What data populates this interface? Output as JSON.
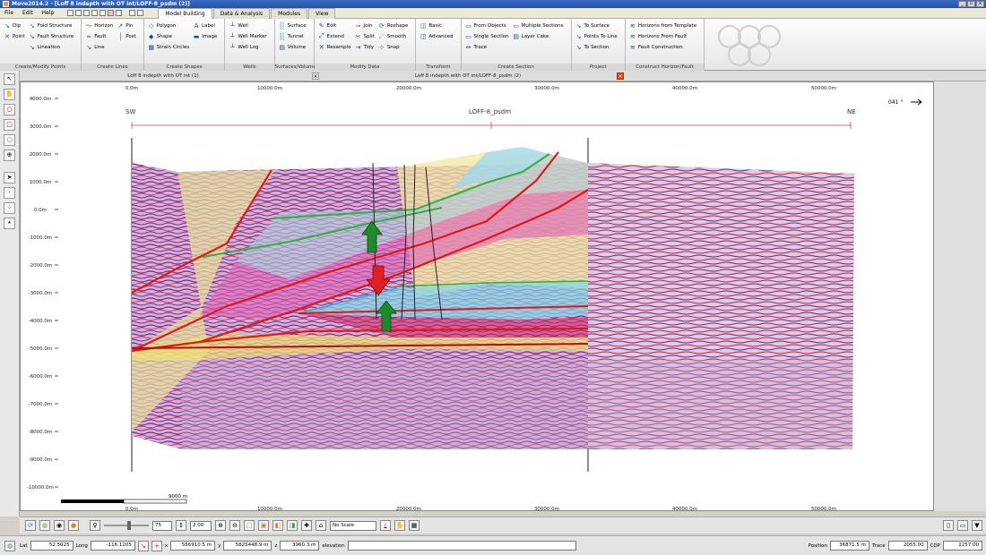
{
  "window": {
    "title": "Move2014.2 - [Loff 8 indepth with OT int/LOFF-8_psdm (2)]"
  },
  "menu": [
    "File",
    "Edit",
    "Help"
  ],
  "tabs": [
    "Model Building",
    "Data & Analysis",
    "Modules",
    "View"
  ],
  "ribbon": {
    "groups": [
      {
        "title": "Create/Modify Points",
        "cols": [
          [
            [
              "↘",
              "Dip"
            ],
            [
              "✕",
              "Point"
            ]
          ],
          [
            [
              "↘",
              "Fold Structure"
            ],
            [
              "↘",
              "Fault Structure"
            ],
            [
              "↘",
              "Lineation"
            ]
          ]
        ]
      },
      {
        "title": "Create Lines",
        "cols": [
          [
            [
              "〜",
              "Horizon"
            ],
            [
              "≈",
              "Fault"
            ],
            [
              "↘",
              "Line"
            ]
          ],
          [
            [
              "↗",
              "Pin"
            ],
            [
              "│",
              "Post"
            ]
          ]
        ]
      },
      {
        "title": "Create Shapes",
        "cols": [
          [
            [
              "◇",
              "Polygon"
            ],
            [
              "◆",
              "Shape"
            ],
            [
              "▦",
              "Strain Circles"
            ]
          ],
          [
            [
              "A",
              "Label"
            ],
            [
              "▬",
              "Image"
            ]
          ]
        ]
      },
      {
        "title": "Wells",
        "cols": [
          [
            [
              "┴",
              "Well"
            ],
            [
              "┴",
              "Well Marker"
            ],
            [
              "┴",
              "Well Log"
            ]
          ]
        ]
      },
      {
        "title": "Surfaces/Volumes",
        "cols": [
          [
            [
              "░",
              "Surface"
            ],
            [
              "░",
              "Tunnel"
            ],
            [
              "▤",
              "Volume"
            ]
          ]
        ]
      },
      {
        "title": "Modify Data",
        "cols": [
          [
            [
              "✎",
              "Edit"
            ],
            [
              "⤢",
              "Extend"
            ],
            [
              "✕",
              "Resample"
            ]
          ],
          [
            [
              "⊸",
              "Join"
            ],
            [
              "✂",
              "Split"
            ],
            [
              "⇥",
              "Tidy"
            ]
          ],
          [
            [
              "⟳",
              "Reshape"
            ],
            [
              "☄",
              "Smooth"
            ],
            [
              "⊹",
              "Snap"
            ]
          ]
        ]
      },
      {
        "title": "Transform",
        "cols": [
          [
            [
              "◫",
              "Basic"
            ],
            [
              "◫",
              "Advanced"
            ]
          ]
        ]
      },
      {
        "title": "Create Section",
        "cols": [
          [
            [
              "▭",
              "From Objects"
            ],
            [
              "▭",
              "Single Section"
            ],
            [
              "↔",
              "Trace"
            ]
          ],
          [
            [
              "▭",
              "Multiple Sections"
            ],
            [
              "▤",
              "Layer Cake"
            ]
          ]
        ]
      },
      {
        "title": "Project",
        "cols": [
          [
            [
              "↘",
              "To Surface"
            ],
            [
              "↘",
              "Points To Line"
            ],
            [
              "↘",
              "To Section"
            ]
          ]
        ]
      },
      {
        "title": "Construct Horizon/Fault",
        "cols": [
          [
            [
              "≋",
              "Horizons from Template"
            ],
            [
              "≋",
              "Horizons From Fault"
            ],
            [
              "≋",
              "Fault Construction"
            ]
          ]
        ]
      }
    ]
  },
  "doc_tabs": {
    "left": "Loff 8 indepth with OT int (1)",
    "right": "Loff 8 indepth with OT int/LOFF-8_psdm (2)"
  },
  "section": {
    "sw": "SW",
    "ne": "NE",
    "name": "LOFF-8_psdm",
    "azimuth": "041 °",
    "x_ticks": [
      "0.0m",
      "10000.0m",
      "20000.0m",
      "30000.0m",
      "40000.0m",
      "50000.0m"
    ],
    "y_ticks": [
      "4000.0m",
      "3000.0m",
      "2000.0m",
      "1000.0m",
      "0.0m",
      "-1000.0m",
      "-2000.0m",
      "-3000.0m",
      "-4000.0m",
      "-5000.0m",
      "-6000.0m",
      "-7000.0m",
      "-8000.0m",
      "-9000.0m",
      "-10000.0m"
    ],
    "scale_label": "9000 m"
  },
  "bottom_toolbar": {
    "zoom": "75",
    "exaggeration": "2.00",
    "scale_select": "No Scale"
  },
  "status": {
    "lat_label": "Lat",
    "lat": "52.5025",
    "long_label": "Long",
    "long": "-116.1205",
    "x_label": "x",
    "x": "556910.5 m",
    "y_label": "y",
    "y": "5825448.9 m",
    "z_label": "z",
    "z": "3960.3 m",
    "z_note": "elevation",
    "position_label": "Position",
    "position": "36871.5 m",
    "trace_label": "Trace",
    "trace": "2055.00",
    "cdp_label": "CDP",
    "cdp": "2257.00"
  },
  "colors": {
    "title_blue": "#2452a8",
    "fault_red": "#e01818",
    "arrow_green": "#1f8a2a",
    "arrow_red": "#e02020"
  }
}
